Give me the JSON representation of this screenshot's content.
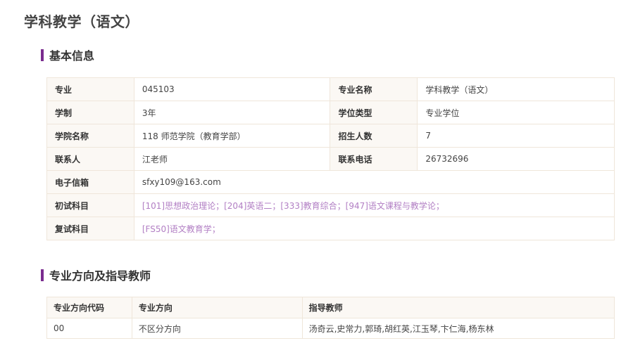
{
  "page": {
    "title": "学科教学（语文）"
  },
  "basic_info": {
    "section_title": "基本信息",
    "rows": [
      {
        "label1": "专业",
        "value1": "045103",
        "label2": "专业名称",
        "value2": "学科教学（语文）"
      },
      {
        "label1": "学制",
        "value1": "3年",
        "label2": "学位类型",
        "value2": "专业学位"
      },
      {
        "label1": "学院名称",
        "value1": "118 师范学院（教育学部）",
        "label2": "招生人数",
        "value2": "7"
      },
      {
        "label1": "联系人",
        "value1": "江老师",
        "label2": "联系电话",
        "value2": "26732696"
      }
    ],
    "email": {
      "label": "电子信箱",
      "value": "sfxy109@163.com"
    },
    "initial_subjects": {
      "label": "初试科目",
      "value": "[101]思想政治理论；[204]英语二；[333]教育综合；[947]语文课程与教学论；"
    },
    "retest_subjects": {
      "label": "复试科目",
      "value": "[FS50]语文教育学；"
    }
  },
  "directions": {
    "section_title": "专业方向及指导教师",
    "headers": [
      "专业方向代码",
      "专业方向",
      "指导教师"
    ],
    "rows": [
      {
        "code": "00",
        "direction": "不区分方向",
        "advisors": "汤奇云,史常力,郭琦,胡红英,江玉琴,卞仁海,杨东林"
      }
    ]
  },
  "colors": {
    "accent": "#7a2c8f",
    "link": "#b27fc4",
    "label_bg": "#fbf8f4",
    "border": "#efe6da"
  }
}
